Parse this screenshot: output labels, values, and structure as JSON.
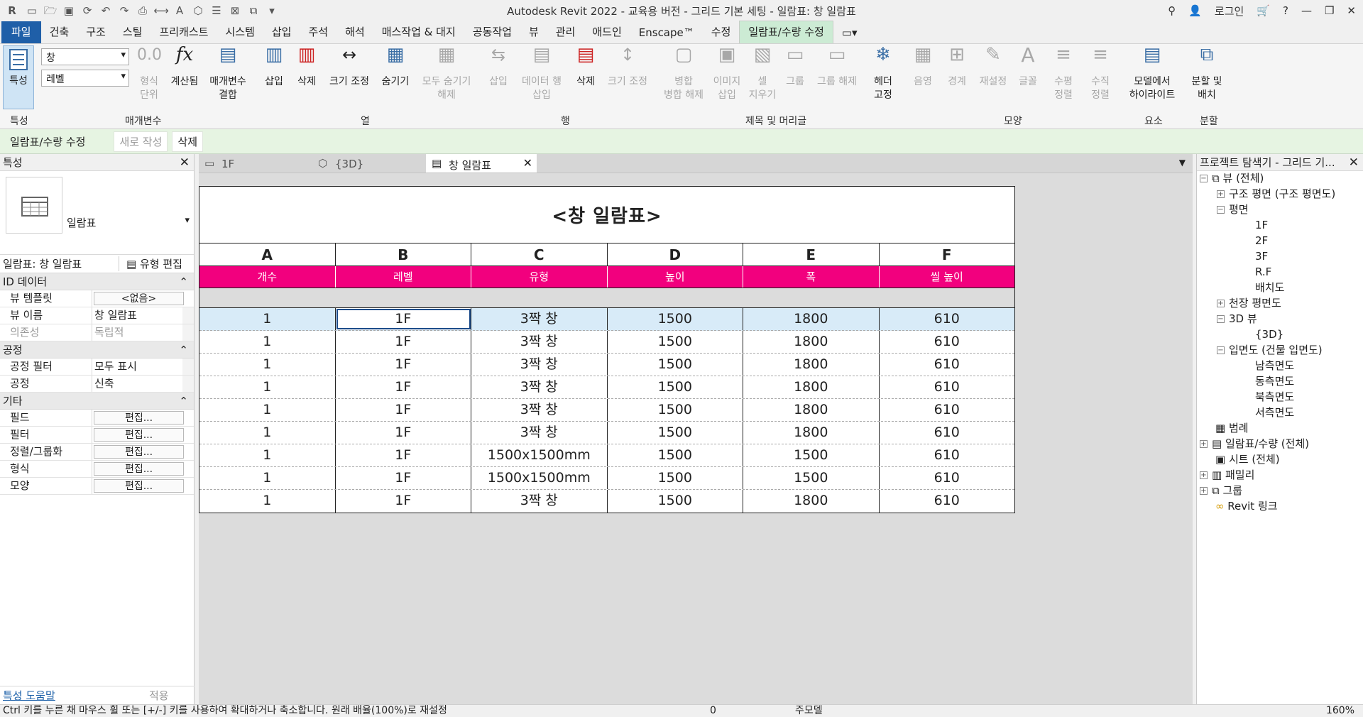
{
  "title_bar": {
    "title": "Autodesk Revit 2022 - 교육용 버전 - 그리드 기본 세팅 - 일람표: 창 일람표",
    "login": "로그인"
  },
  "ribbon_tabs": [
    "파일",
    "건축",
    "구조",
    "스틸",
    "프리캐스트",
    "시스템",
    "삽입",
    "주석",
    "해석",
    "매스작업 & 대지",
    "공동작업",
    "뷰",
    "관리",
    "애드인",
    "Enscape™",
    "수정",
    "일람표/수량 수정"
  ],
  "ribbon": {
    "properties_btn": "특성",
    "type_dropdown": "창",
    "level_dropdown": "레벨",
    "format_unit": "형식\n단위",
    "calculated": "계산됨",
    "combine_params": "매개변수\n결합",
    "insert": "삽입",
    "delete": "삭제",
    "resize": "크기 조정",
    "hide": "숨기기",
    "unhide_all": "모두 숨기기\n해제",
    "row_insert": "삽입",
    "data_row_insert": "데이터 행\n삽입",
    "row_delete": "삭제",
    "row_resize": "크기 조정",
    "merge_unmerge": "병합\n병합 해제",
    "insert_image": "이미지\n삽입",
    "clear_cell": "셀\n지우기",
    "group": "그룹",
    "ungroup": "그룹 해제",
    "freeze_header": "헤더\n고정",
    "shading": "음영",
    "borders": "경계",
    "reset": "재설정",
    "font": "글꼴",
    "align_h": "수평\n정렬",
    "align_v": "수직\n정렬",
    "highlight_in_model": "모델에서\n하이라이트",
    "split_place": "분할 및\n배치",
    "groups": {
      "properties": "특성",
      "parameters": "매개변수",
      "columns": "열",
      "rows": "행",
      "titles_headers": "제목 및 머리글",
      "appearance": "모양",
      "element": "요소",
      "split": "분할"
    }
  },
  "option_bar": {
    "label": "일람표/수량 수정",
    "new": "새로 작성",
    "delete": "삭제"
  },
  "properties_panel": {
    "title": "특성",
    "type_label": "일람표",
    "instance_selector": "일람표: 창 일람표",
    "edit_type": "유형 편집",
    "group_id": "ID 데이터",
    "group_phase": "공정",
    "group_other": "기타",
    "rows_id": [
      {
        "k": "뷰 템플릿",
        "v": "<없음>"
      },
      {
        "k": "뷰 이름",
        "v": "창 일람표"
      },
      {
        "k": "의존성",
        "v": "독립적"
      }
    ],
    "rows_phase": [
      {
        "k": "공정 필터",
        "v": "모두 표시"
      },
      {
        "k": "공정",
        "v": "신축"
      }
    ],
    "rows_other": [
      {
        "k": "필드",
        "v": "편집..."
      },
      {
        "k": "필터",
        "v": "편집..."
      },
      {
        "k": "정렬/그룹화",
        "v": "편집..."
      },
      {
        "k": "형식",
        "v": "편집..."
      },
      {
        "k": "모양",
        "v": "편집..."
      }
    ],
    "help": "특성 도움말",
    "apply": "적용"
  },
  "view_tabs": [
    "1F",
    "{3D}",
    "창 일람표"
  ],
  "schedule": {
    "title": "<창 일람표>",
    "columns": [
      "A",
      "B",
      "C",
      "D",
      "E",
      "F"
    ],
    "fields": [
      "개수",
      "레벨",
      "유형",
      "높이",
      "폭",
      "씰 높이"
    ],
    "rows": [
      [
        "1",
        "1F",
        "3짝 창",
        "1500",
        "1800",
        "610"
      ],
      [
        "1",
        "1F",
        "3짝 창",
        "1500",
        "1800",
        "610"
      ],
      [
        "1",
        "1F",
        "3짝 창",
        "1500",
        "1800",
        "610"
      ],
      [
        "1",
        "1F",
        "3짝 창",
        "1500",
        "1800",
        "610"
      ],
      [
        "1",
        "1F",
        "3짝 창",
        "1500",
        "1800",
        "610"
      ],
      [
        "1",
        "1F",
        "3짝 창",
        "1500",
        "1800",
        "610"
      ],
      [
        "1",
        "1F",
        "1500x1500mm",
        "1500",
        "1500",
        "610"
      ],
      [
        "1",
        "1F",
        "1500x1500mm",
        "1500",
        "1500",
        "610"
      ],
      [
        "1",
        "1F",
        "3짝 창",
        "1500",
        "1800",
        "610"
      ]
    ]
  },
  "project_browser": {
    "title": "프로젝트 탐색기 - 그리드 기...",
    "views_all": "뷰 (전체)",
    "structural_plans": "구조 평면 (구조 평면도)",
    "floor_plans": "평면",
    "plans": [
      "1F",
      "2F",
      "3F",
      "R.F",
      "배치도"
    ],
    "ceiling_plans": "천장 평면도",
    "views_3d": "3D 뷰",
    "view_3d": "{3D}",
    "elevations": "입면도 (건물 입면도)",
    "elevation_items": [
      "남측면도",
      "동측면도",
      "북측면도",
      "서측면도"
    ],
    "legends": "범례",
    "schedules": "일람표/수량 (전체)",
    "sheets": "시트 (전체)",
    "families": "패밀리",
    "groups": "그룹",
    "revit_links": "Revit 링크"
  },
  "status_bar": {
    "message": "Ctrl 키를 누른 채 마우스 휠 또는 [+/-] 키를 사용하여 확대하거나 축소합니다. 원래 배율(100%)로 재설정",
    "zero": "0",
    "main_model": "주모델",
    "zoom": "160%"
  },
  "colors": {
    "file_tab": "#1f5fa8",
    "active_tab": "#ccebd4",
    "field_header": "#f2007e",
    "selected_row": "#d8ebf8"
  }
}
